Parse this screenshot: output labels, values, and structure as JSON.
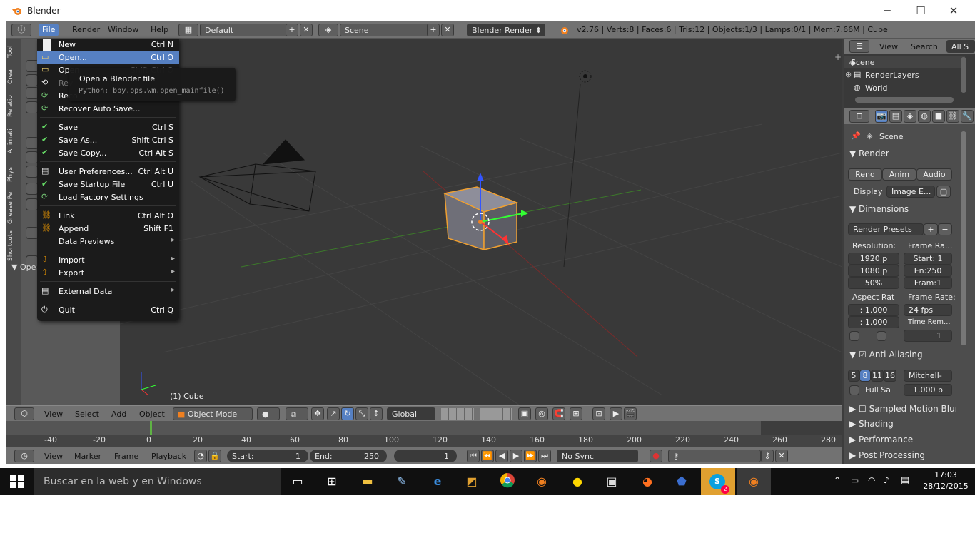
{
  "window": {
    "title": "Blender",
    "minimize": "─",
    "maximize": "☐",
    "close": "✕"
  },
  "infobar": {
    "menus": [
      "File",
      "Render",
      "Window",
      "Help"
    ],
    "layout": "Default",
    "scene": "Scene",
    "engine": "Blender Render",
    "stats": "v2.76 | Verts:8 | Faces:6 | Tris:12 | Objects:1/3 | Lamps:0/1 | Mem:7.66M | Cube"
  },
  "file_menu": {
    "items": [
      {
        "label": "New",
        "shortcut": "Ctrl N",
        "icon": "new-file-icon"
      },
      {
        "label": "Open...",
        "shortcut": "Ctrl O",
        "icon": "folder-open-icon",
        "highlighted": true
      },
      {
        "label": "Open",
        "shortcut": "Shift Ctrl O",
        "icon": "folder-icon"
      },
      {
        "label": "Rev",
        "shortcut": "",
        "icon": "revert-icon"
      },
      {
        "label": "Reco",
        "shortcut": "",
        "icon": "recover-icon"
      },
      {
        "label": "Recover Auto Save...",
        "shortcut": "",
        "icon": "recover-autosave-icon"
      },
      {
        "label": "Save",
        "shortcut": "Ctrl S",
        "icon": "save-check-icon"
      },
      {
        "label": "Save As...",
        "shortcut": "Shift Ctrl S",
        "icon": "save-as-icon"
      },
      {
        "label": "Save Copy...",
        "shortcut": "Ctrl Alt S",
        "icon": "save-copy-icon"
      },
      {
        "label": "User Preferences...",
        "shortcut": "Ctrl Alt U",
        "icon": "preferences-icon"
      },
      {
        "label": "Save Startup File",
        "shortcut": "Ctrl U",
        "icon": "save-startup-icon"
      },
      {
        "label": "Load Factory Settings",
        "shortcut": "",
        "icon": "factory-settings-icon"
      },
      {
        "label": "Link",
        "shortcut": "Ctrl Alt O",
        "icon": "link-icon"
      },
      {
        "label": "Append",
        "shortcut": "Shift F1",
        "icon": "append-icon"
      },
      {
        "label": "Data Previews",
        "shortcut": "",
        "icon": "",
        "submenu": true
      },
      {
        "label": "Import",
        "shortcut": "",
        "icon": "import-icon",
        "submenu": true
      },
      {
        "label": "Export",
        "shortcut": "",
        "icon": "export-icon",
        "submenu": true
      },
      {
        "label": "External Data",
        "shortcut": "",
        "icon": "external-data-icon",
        "submenu": true
      },
      {
        "label": "Quit",
        "shortcut": "Ctrl Q",
        "icon": "quit-icon"
      }
    ]
  },
  "tooltip": {
    "title": "Open a Blender file",
    "python": "Python: bpy.ops.wm.open_mainfile()"
  },
  "tool_tabs": [
    "Tool",
    "Crea",
    "Relatio",
    "Animati",
    "Physi",
    "Grease Pe",
    "Shortcuts"
  ],
  "tool_panel": {
    "ops_label": "Ope"
  },
  "viewport": {
    "object_label": "(1) Cube"
  },
  "view3d_header": {
    "menus": [
      "View",
      "Select",
      "Add",
      "Object"
    ],
    "mode": "Object Mode",
    "orientation": "Global"
  },
  "timeline": {
    "ticks": [
      "-40",
      "-20",
      "0",
      "20",
      "40",
      "60",
      "80",
      "100",
      "120",
      "140",
      "160",
      "180",
      "200",
      "220",
      "240",
      "260",
      "280"
    ],
    "menus": [
      "View",
      "Marker",
      "Frame",
      "Playback"
    ],
    "start_label": "Start:",
    "start": "1",
    "end_label": "End:",
    "end": "250",
    "current": "1",
    "sync": "No Sync"
  },
  "outliner": {
    "header": {
      "view": "View",
      "search": "Search",
      "filter": "All S"
    },
    "items": [
      "Scene",
      "RenderLayers",
      "World"
    ]
  },
  "properties": {
    "context": "Scene",
    "render_title": "Render",
    "render_buttons": [
      "Rend",
      "Anim",
      "Audio"
    ],
    "display_label": "Display",
    "display_value": "Image E...",
    "dimensions_title": "Dimensions",
    "presets": "Render Presets",
    "resolution_label": "Resolution:",
    "res_x": "1920 p",
    "res_y": "1080 p",
    "res_pct": "50%",
    "frame_range_label": "Frame Ra...",
    "start": "Start: 1",
    "end": "En:250",
    "frame_step": "Fram:1",
    "aspect_label": "Aspect Rat",
    "aspect_x": ": 1.000",
    "aspect_y": ": 1.000",
    "framerate_label": "Frame Rate:",
    "framerate": "24 fps",
    "time_remap_label": "Time Rem...",
    "time_remap_val": "1",
    "aa_title": "Anti-Aliasing",
    "aa_samples": [
      "5",
      "8",
      "11",
      "16"
    ],
    "aa_filter": "Mitchell-",
    "full_sample": "Full Sa",
    "filter_size": "1.000 p",
    "panels": [
      "Sampled Motion Blur",
      "Shading",
      "Performance",
      "Post Processing"
    ]
  },
  "taskbar": {
    "search_placeholder": "Buscar en la web y en Windows",
    "time": "17:03",
    "date": "28/12/2015",
    "skype_badge": "2"
  },
  "colors": {
    "accent": "#5680c2",
    "selected_outline": "#f0a030",
    "taskbar": "#101010"
  }
}
